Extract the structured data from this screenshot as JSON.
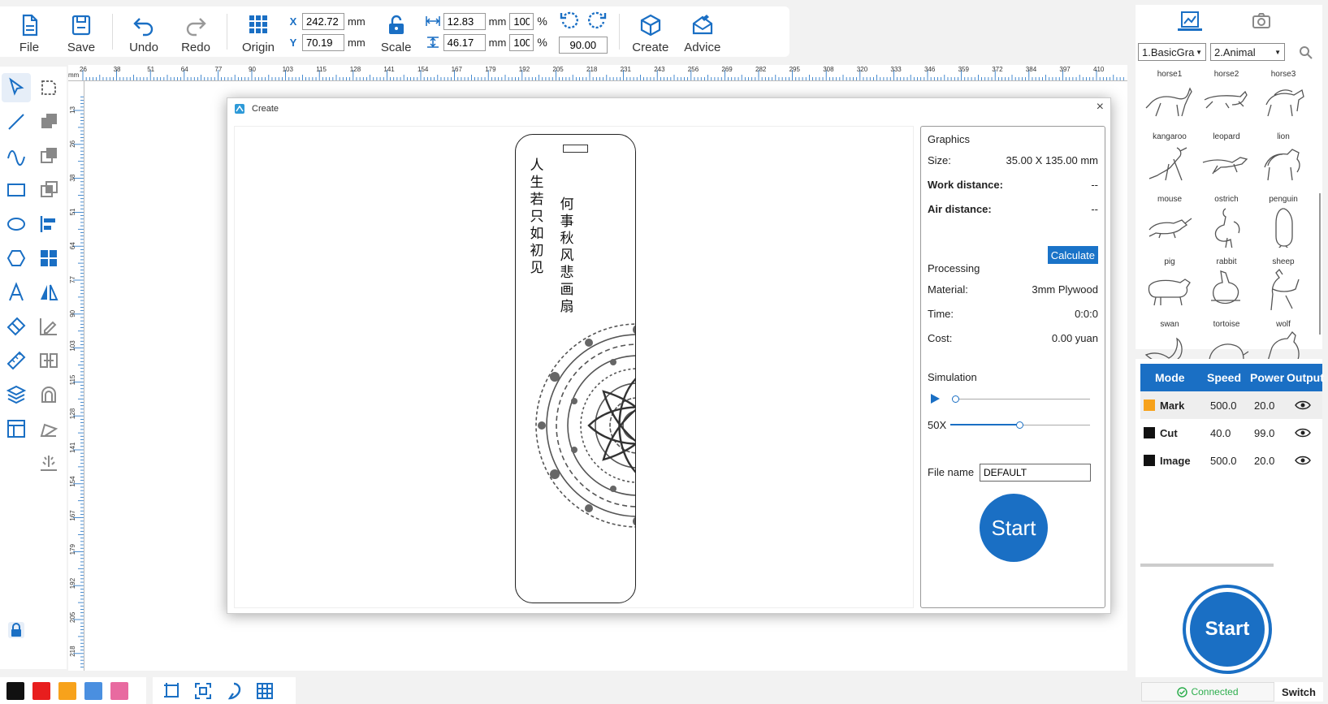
{
  "toolbar": {
    "file": "File",
    "save": "Save",
    "undo": "Undo",
    "redo": "Redo",
    "origin": "Origin",
    "x_label": "X",
    "y_label": "Y",
    "x_value": "242.72",
    "y_value": "70.19",
    "unit": "mm",
    "scale": "Scale",
    "width_value": "12.83",
    "height_value": "46.17",
    "width_pct": "100",
    "height_pct": "100",
    "pct": "%",
    "rotation": "90.00",
    "create": "Create",
    "advice": "Advice"
  },
  "rulers": {
    "unit": "mm",
    "top_ticks": [
      "26",
      "38",
      "51",
      "64",
      "77",
      "90",
      "103",
      "115",
      "128",
      "141",
      "154",
      "167",
      "179",
      "192",
      "205",
      "218",
      "231",
      "243",
      "256",
      "269",
      "282",
      "295",
      "308",
      "320",
      "333",
      "346",
      "359",
      "372",
      "384",
      "397",
      "410"
    ],
    "left_ticks": [
      "13",
      "26",
      "38",
      "51",
      "64",
      "77",
      "90",
      "103",
      "115",
      "128",
      "141",
      "154",
      "167",
      "179",
      "192",
      "205",
      "218"
    ]
  },
  "palette": {
    "colors": [
      "#111111",
      "#e81e1e",
      "#f7a21b",
      "#4a8fe0",
      "#e86aa0"
    ]
  },
  "dialog": {
    "title": "Create",
    "close": "×",
    "bookmark_text_col1": [
      "人",
      "生",
      "若",
      "只",
      "如",
      "初",
      "见"
    ],
    "bookmark_text_col2": [
      "何",
      "事",
      "秋",
      "风",
      "悲",
      "画",
      "扇"
    ],
    "graphics_heading": "Graphics",
    "size_label": "Size:",
    "size_value": "35.00 X 135.00 mm",
    "work_distance_label": "Work distance:",
    "work_distance_value": "--",
    "air_distance_label": "Air distance:",
    "air_distance_value": "--",
    "calculate": "Calculate",
    "processing_heading": "Processing",
    "material_label": "Material:",
    "material_value": "3mm Plywood",
    "time_label": "Time:",
    "time_value": "0:0:0",
    "cost_label": "Cost:",
    "cost_value": "0.00 yuan",
    "simulation_heading": "Simulation",
    "speed_label": "50X",
    "file_name_label": "File name",
    "file_name_value": "DEFAULT",
    "start": "Start"
  },
  "library": {
    "category1": "1.BasicGra",
    "category2": "2.Animal",
    "items": [
      "horse1",
      "horse2",
      "horse3",
      "kangaroo",
      "leopard",
      "lion",
      "mouse",
      "ostrich",
      "penguin",
      "pig",
      "rabbit",
      "sheep",
      "swan",
      "tortoise",
      "wolf"
    ]
  },
  "layers": {
    "headers": [
      "Mode",
      "Speed",
      "Power",
      "Output"
    ],
    "rows": [
      {
        "mode": "Mark",
        "speed": "500.0",
        "power": "20.0",
        "color": "#f7a21b"
      },
      {
        "mode": "Cut",
        "speed": "40.0",
        "power": "99.0",
        "color": "#111111"
      },
      {
        "mode": "Image",
        "speed": "500.0",
        "power": "20.0",
        "color": "#111111"
      }
    ]
  },
  "main_start": "Start",
  "status": {
    "connected": "Connected",
    "switch": "Switch"
  }
}
